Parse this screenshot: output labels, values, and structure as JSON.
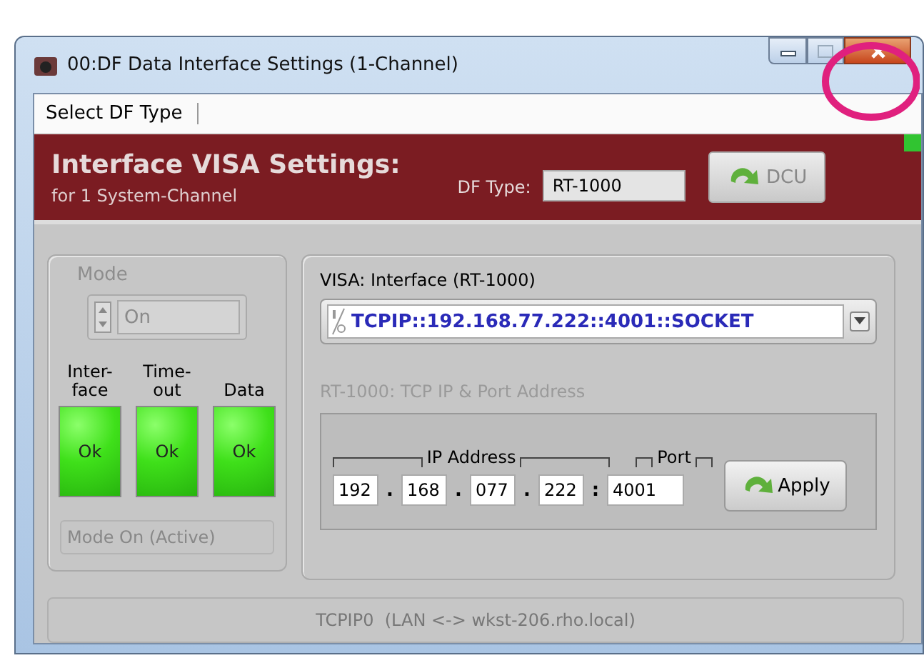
{
  "window": {
    "title": "00:DF Data Interface Settings (1-Channel)"
  },
  "menu": [
    {
      "label": "Select DF Type"
    }
  ],
  "header": {
    "title": "Interface VISA Settings:",
    "subtitle": "for 1 System-Channel",
    "df_type_label": "DF Type:",
    "df_type_value": "RT-1000",
    "dcu_button": {
      "label": "DCU",
      "disabled": true
    },
    "led_on": true
  },
  "mode": {
    "label": "Mode",
    "value": "On",
    "disabled": true
  },
  "indicators": [
    {
      "label": "Inter-\nface",
      "text": "Ok",
      "on": true
    },
    {
      "label": "Time-\nout",
      "text": "Ok",
      "on": true
    },
    {
      "label": "Data",
      "text": "Ok",
      "on": true
    }
  ],
  "mode_status": "Mode On (Active)",
  "visa": {
    "label": "VISA: Interface (RT-1000)",
    "value": "TCPIP::192.168.77.222::4001::SOCKET"
  },
  "tcp": {
    "label": "RT-1000: TCP IP & Port Address",
    "disabled": true,
    "ip_label": "IP Address",
    "port_label": "Port",
    "apply_button": "Apply",
    "fields": [
      {
        "kind": "octet",
        "value": "192"
      },
      {
        "kind": "sep",
        "text": "."
      },
      {
        "kind": "octet",
        "value": "168"
      },
      {
        "kind": "sep",
        "text": "."
      },
      {
        "kind": "octet",
        "value": "077"
      },
      {
        "kind": "sep",
        "text": "."
      },
      {
        "kind": "octet",
        "value": "222"
      },
      {
        "kind": "sep",
        "text": ":"
      },
      {
        "kind": "port",
        "value": "4001"
      }
    ]
  },
  "status_bar": "TCPIP0  (LAN <-> wkst-206.rho.local)"
}
